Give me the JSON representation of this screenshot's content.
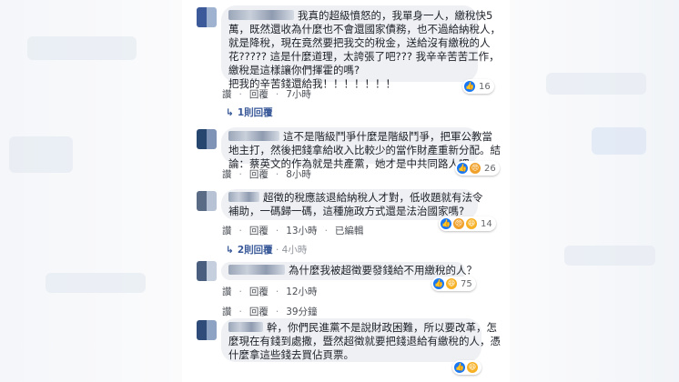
{
  "comments": [
    {
      "lines": [
        "我真的超級憤怒的，我單身一人，繳稅快5",
        "萬，既然還收為什麼也不會還國家債務，也不過給納稅人，",
        "就是降稅，現在竟然要把我交的稅金，送給沒有繳稅的人",
        "花????? 這是什麼道理，太誇張了吧??? 我辛辛苦苦工作，",
        "繳稅是這樣讓你們揮霍的嗎?",
        "把我的辛苦錢還給我！！！！！！！"
      ],
      "reaction_count": "16",
      "actions": [
        "讚",
        "回覆",
        "7小時"
      ],
      "replies_label": "1則回覆",
      "replies_time": ""
    },
    {
      "lines": [
        "這不是階級鬥爭什麼是階級鬥爭，把軍公教當",
        "地主打，然後把錢拿給收入比較少的當作財產重新分配。結",
        "論：蔡英文的作為就是共產黨，她才是中共同路人吧"
      ],
      "reaction_count": "26",
      "actions": [
        "讚",
        "回覆",
        "8小時"
      ]
    },
    {
      "lines": [
        "超徵的稅應該退給納稅人才對，低收題就有法令",
        "補助，一碼歸一碼，這種施政方式還是法治國家嗎?"
      ],
      "reaction_count": "14",
      "actions": [
        "讚",
        "回覆",
        "13小時",
        "已編輯"
      ],
      "replies_label": "2則回覆",
      "replies_time": "4小時"
    },
    {
      "lines": [
        "為什麼我被超徵要發錢給不用繳稅的人？"
      ],
      "reaction_count": "75",
      "actions": [
        "讚",
        "回覆",
        "12小時"
      ]
    },
    {
      "lines": [],
      "reaction_count": "",
      "actions": [
        "讚",
        "回覆",
        "39分鐘"
      ]
    },
    {
      "lines": [
        "幹，你們民進黨不是說財政困難，所以要改革，怎",
        "麼現在有錢到處撒，暨然超徵就要把錢退給有繳稅的人，憑",
        "什麼拿這些錢去買佔頁票。"
      ],
      "reaction_count": "",
      "actions": []
    }
  ],
  "colors": {
    "bubble": "#eef0f3",
    "link": "#385898",
    "like": "#1877f2"
  }
}
